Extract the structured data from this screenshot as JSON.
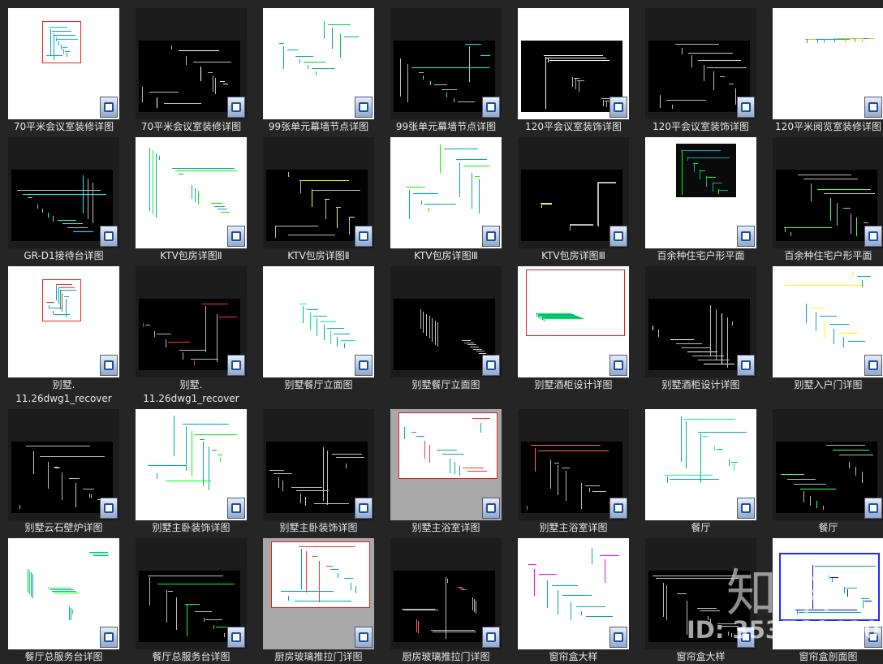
{
  "files": [
    {
      "caption": "70平米会议室装修详图",
      "bg": "white",
      "art": "small-red",
      "accent": "#00cccc"
    },
    {
      "caption": "70平米会议室装修详图",
      "bg": "dark",
      "art": "black-sheet",
      "accent": "#ffffff"
    },
    {
      "caption": "99张单元幕墙节点详图",
      "bg": "white",
      "art": "green-rows",
      "accent": "#00cc44"
    },
    {
      "caption": "99张单元幕墙节点详图",
      "bg": "dark",
      "art": "black-sheet",
      "accent": "#00ffff"
    },
    {
      "caption": "120平会议室装饰详图",
      "bg": "white",
      "art": "black-sheet",
      "accent": "#ffffff"
    },
    {
      "caption": "120平会议室装饰详图",
      "bg": "dark",
      "art": "black-sheet",
      "accent": "#cccccc"
    },
    {
      "caption": "120平米阅览室装修详图",
      "bg": "white",
      "art": "thin-strip",
      "accent": "#cccc00"
    },
    {
      "caption": "GR-D1接待台详图",
      "bg": "dark",
      "art": "black-sheet",
      "accent": "#00ffff"
    },
    {
      "caption": "KTV包房详图Ⅱ",
      "bg": "white",
      "art": "colorful",
      "accent": "#00ff00"
    },
    {
      "caption": "KTV包房详图Ⅱ",
      "bg": "dark",
      "art": "black-sheet",
      "accent": "#ffff00"
    },
    {
      "caption": "KTV包房详图Ⅲ",
      "bg": "white",
      "art": "colorful",
      "accent": "#00ff00"
    },
    {
      "caption": "KTV包房详图Ⅲ",
      "bg": "dark",
      "art": "black-sheet",
      "accent": "#ffff00"
    },
    {
      "caption": "百余种住宅户形平面",
      "bg": "white",
      "art": "green-block",
      "accent": "#00ff00"
    },
    {
      "caption": "百余种住宅户形平面",
      "bg": "dark",
      "art": "black-sheet",
      "accent": "#55ff55"
    },
    {
      "caption": "别墅.\n11.26dwg1_recover",
      "bg": "white",
      "art": "small-red",
      "accent": "#ff3333"
    },
    {
      "caption": "别墅.\n11.26dwg1_recover",
      "bg": "dark",
      "art": "black-sheet",
      "accent": "#ff3333"
    },
    {
      "caption": "别墅餐厅立面图",
      "bg": "white",
      "art": "colorful",
      "accent": "#00ff88"
    },
    {
      "caption": "别墅餐厅立面图",
      "bg": "dark",
      "art": "black-sheet",
      "accent": "#cccccc"
    },
    {
      "caption": "别墅酒柜设计详图",
      "bg": "white",
      "art": "red-frame",
      "accent": "#00ff00"
    },
    {
      "caption": "别墅酒柜设计详图",
      "bg": "dark",
      "art": "black-sheet",
      "accent": "#ffffff"
    },
    {
      "caption": "别墅入户门详图",
      "bg": "white",
      "art": "colorful",
      "accent": "#ffff00"
    },
    {
      "caption": "别墅云石壁炉详图",
      "bg": "dark",
      "art": "black-sheet",
      "accent": "#cccccc"
    },
    {
      "caption": "别墅主卧装饰详图",
      "bg": "white",
      "art": "colorful",
      "accent": "#00ff00"
    },
    {
      "caption": "别墅主卧装饰详图",
      "bg": "dark",
      "art": "black-sheet",
      "accent": "#cccccc"
    },
    {
      "caption": "别墅主浴室详图",
      "bg": "gray",
      "art": "red-frame",
      "accent": "#ff3333"
    },
    {
      "caption": "别墅主浴室详图",
      "bg": "dark",
      "art": "black-sheet",
      "accent": "#ff6666"
    },
    {
      "caption": "餐厅",
      "bg": "white",
      "art": "colorful",
      "accent": "#00ff88"
    },
    {
      "caption": "餐厅",
      "bg": "dark",
      "art": "black-sheet",
      "accent": "#55ff55"
    },
    {
      "caption": "餐厅总服务台详图",
      "bg": "white",
      "art": "colorful",
      "accent": "#00ff00"
    },
    {
      "caption": "餐厅总服务台详图",
      "bg": "dark",
      "art": "black-sheet",
      "accent": "#00ff44"
    },
    {
      "caption": "厨房玻璃推拉门详图",
      "bg": "gray",
      "art": "red-frame",
      "accent": "#ff3333"
    },
    {
      "caption": "厨房玻璃推拉门详图",
      "bg": "dark",
      "art": "black-sheet",
      "accent": "#ff6666"
    },
    {
      "caption": "窗帘盒大样",
      "bg": "white",
      "art": "colorful",
      "accent": "#ff00ff"
    },
    {
      "caption": "窗帘盒大样",
      "bg": "dark",
      "art": "black-sheet",
      "accent": "#cccccc"
    },
    {
      "caption": "窗帘盒剖面图",
      "bg": "white",
      "art": "blue-plan",
      "accent": "#0000ff"
    }
  ],
  "overlay": {
    "logo": "知末",
    "id_text": "ID: 353789620"
  }
}
